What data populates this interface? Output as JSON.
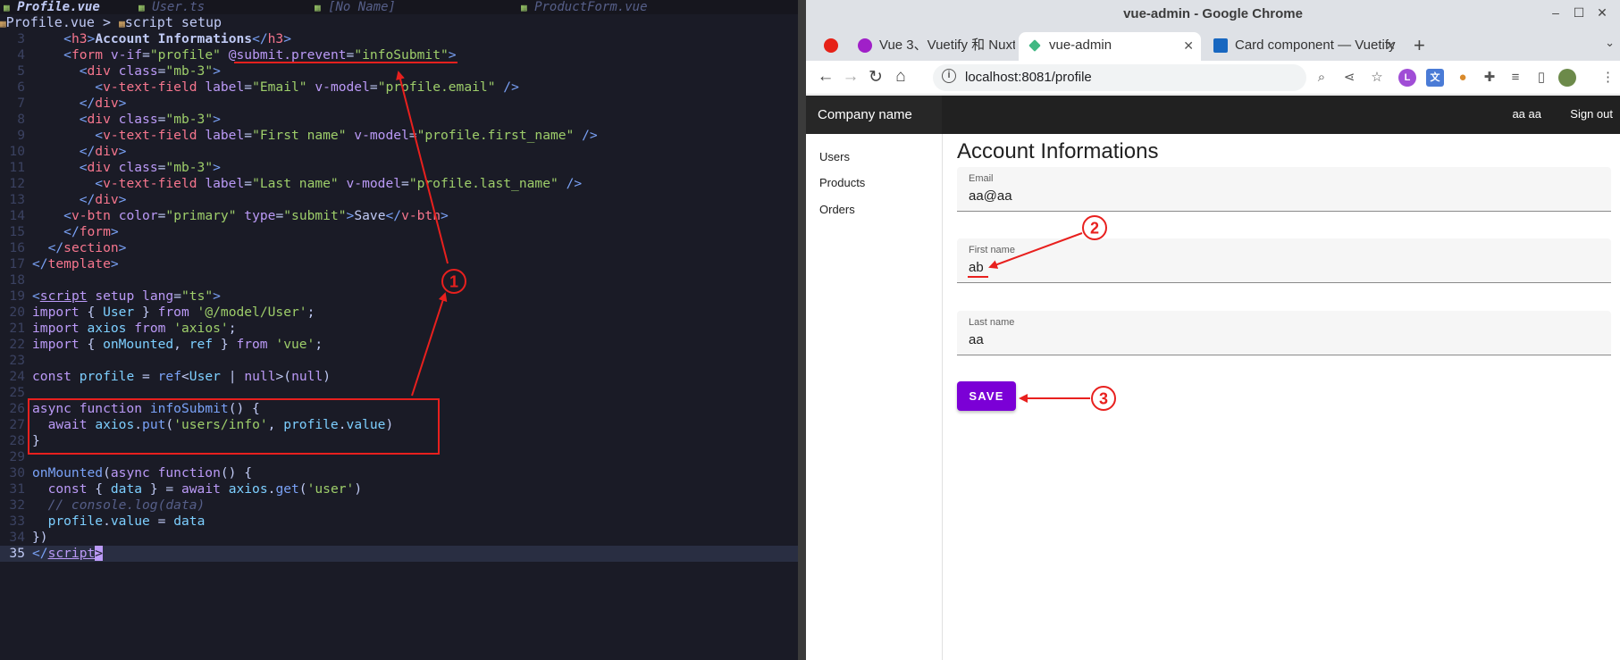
{
  "editor": {
    "tabs": [
      {
        "label": "Profile.vue",
        "active": true
      },
      {
        "label": "User.ts",
        "active": false
      },
      {
        "label": "[No Name]",
        "active": false
      },
      {
        "label": "ProductForm.vue",
        "active": false
      }
    ],
    "winbar": {
      "file": "Profile.vue",
      "sep": ">",
      "symbol": "script setup"
    },
    "current_line": 35
  },
  "browser": {
    "window_title": "vue-admin - Google Chrome",
    "tabs": [
      {
        "label": "Vue 3、Vuetify 和 Nuxt.js",
        "active": false
      },
      {
        "label": "vue-admin",
        "active": true
      },
      {
        "label": "Card component — Vuetify",
        "active": false
      }
    ],
    "url": "localhost:8081/profile",
    "page": {
      "company": "Company name",
      "user": "aa aa",
      "sign_out": "Sign out",
      "nav": [
        "Users",
        "Products",
        "Orders"
      ],
      "heading": "Account Informations",
      "fields": [
        {
          "label": "Email",
          "value": "aa@aa"
        },
        {
          "label": "First name",
          "value": "ab"
        },
        {
          "label": "Last name",
          "value": "aa"
        }
      ],
      "save_label": "SAVE"
    }
  },
  "annotations": {
    "markers": [
      "1",
      "2",
      "3"
    ],
    "color": "#e8201e"
  },
  "colors": {
    "editor_bg": "#1a1b26",
    "primary": "#7b00d6",
    "appbar": "#212121"
  }
}
